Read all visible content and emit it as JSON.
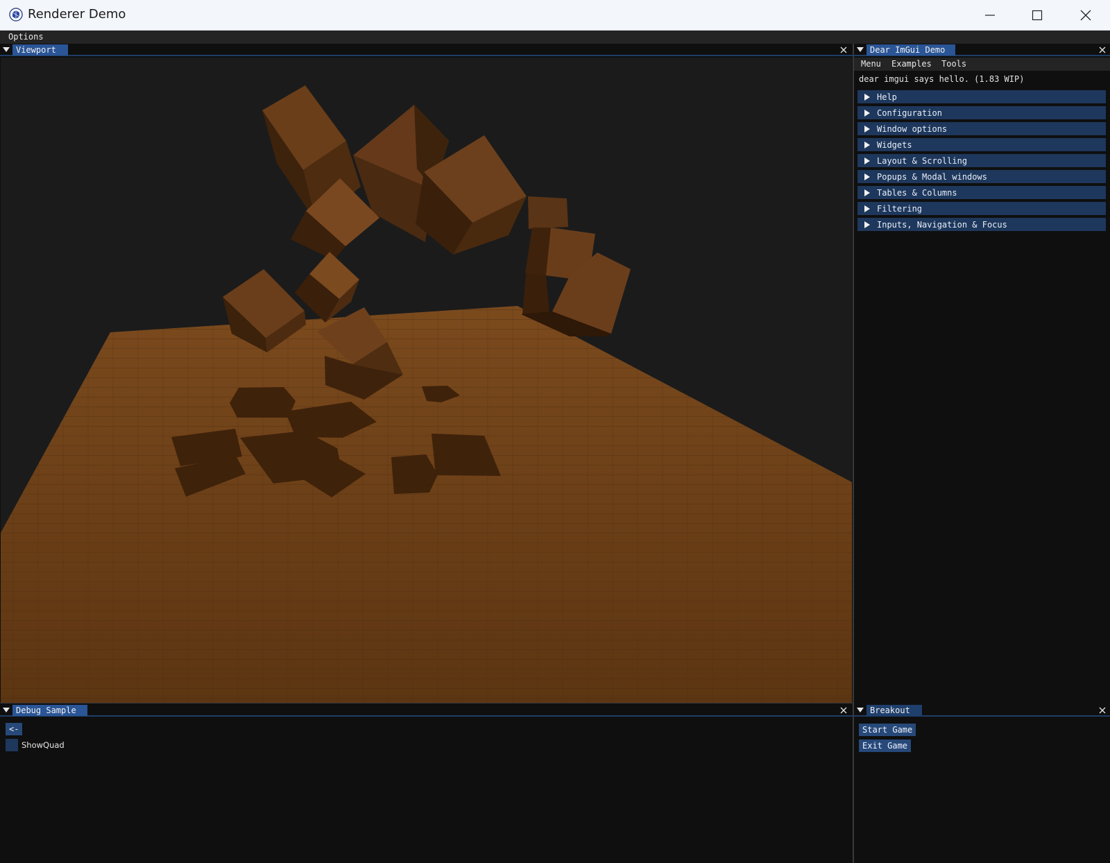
{
  "window": {
    "title": "Renderer Demo",
    "icon": "app-logo-icon",
    "controls": [
      "minimize-icon",
      "maximize-icon",
      "close-icon"
    ]
  },
  "menubar": {
    "items": [
      "Options"
    ]
  },
  "viewport": {
    "tab_label": "Viewport",
    "scene": {
      "background": "#1b1b1b",
      "floor_color": "#6b3f17",
      "cube_color": "#5a3416"
    }
  },
  "imgui_demo": {
    "tab_label": "Dear ImGui Demo",
    "menu": [
      "Menu",
      "Examples",
      "Tools"
    ],
    "hello_text": "dear imgui says hello. (1.83 WIP)",
    "sections": [
      "Help",
      "Configuration",
      "Window options",
      "Widgets",
      "Layout & Scrolling",
      "Popups & Modal windows",
      "Tables & Columns",
      "Filtering",
      "Inputs, Navigation & Focus"
    ]
  },
  "debug_sample": {
    "tab_label": "Debug Sample",
    "back_button": "<-",
    "checkbox_label": "ShowQuad",
    "checkbox_checked": false
  },
  "breakout": {
    "tab_label": "Breakout",
    "start_button": "Start Game",
    "exit_button": "Exit Game"
  },
  "colors": {
    "accent": "#2a5596",
    "header": "#1e375c",
    "panel": "#0f0f0f",
    "menubar": "#242424"
  }
}
